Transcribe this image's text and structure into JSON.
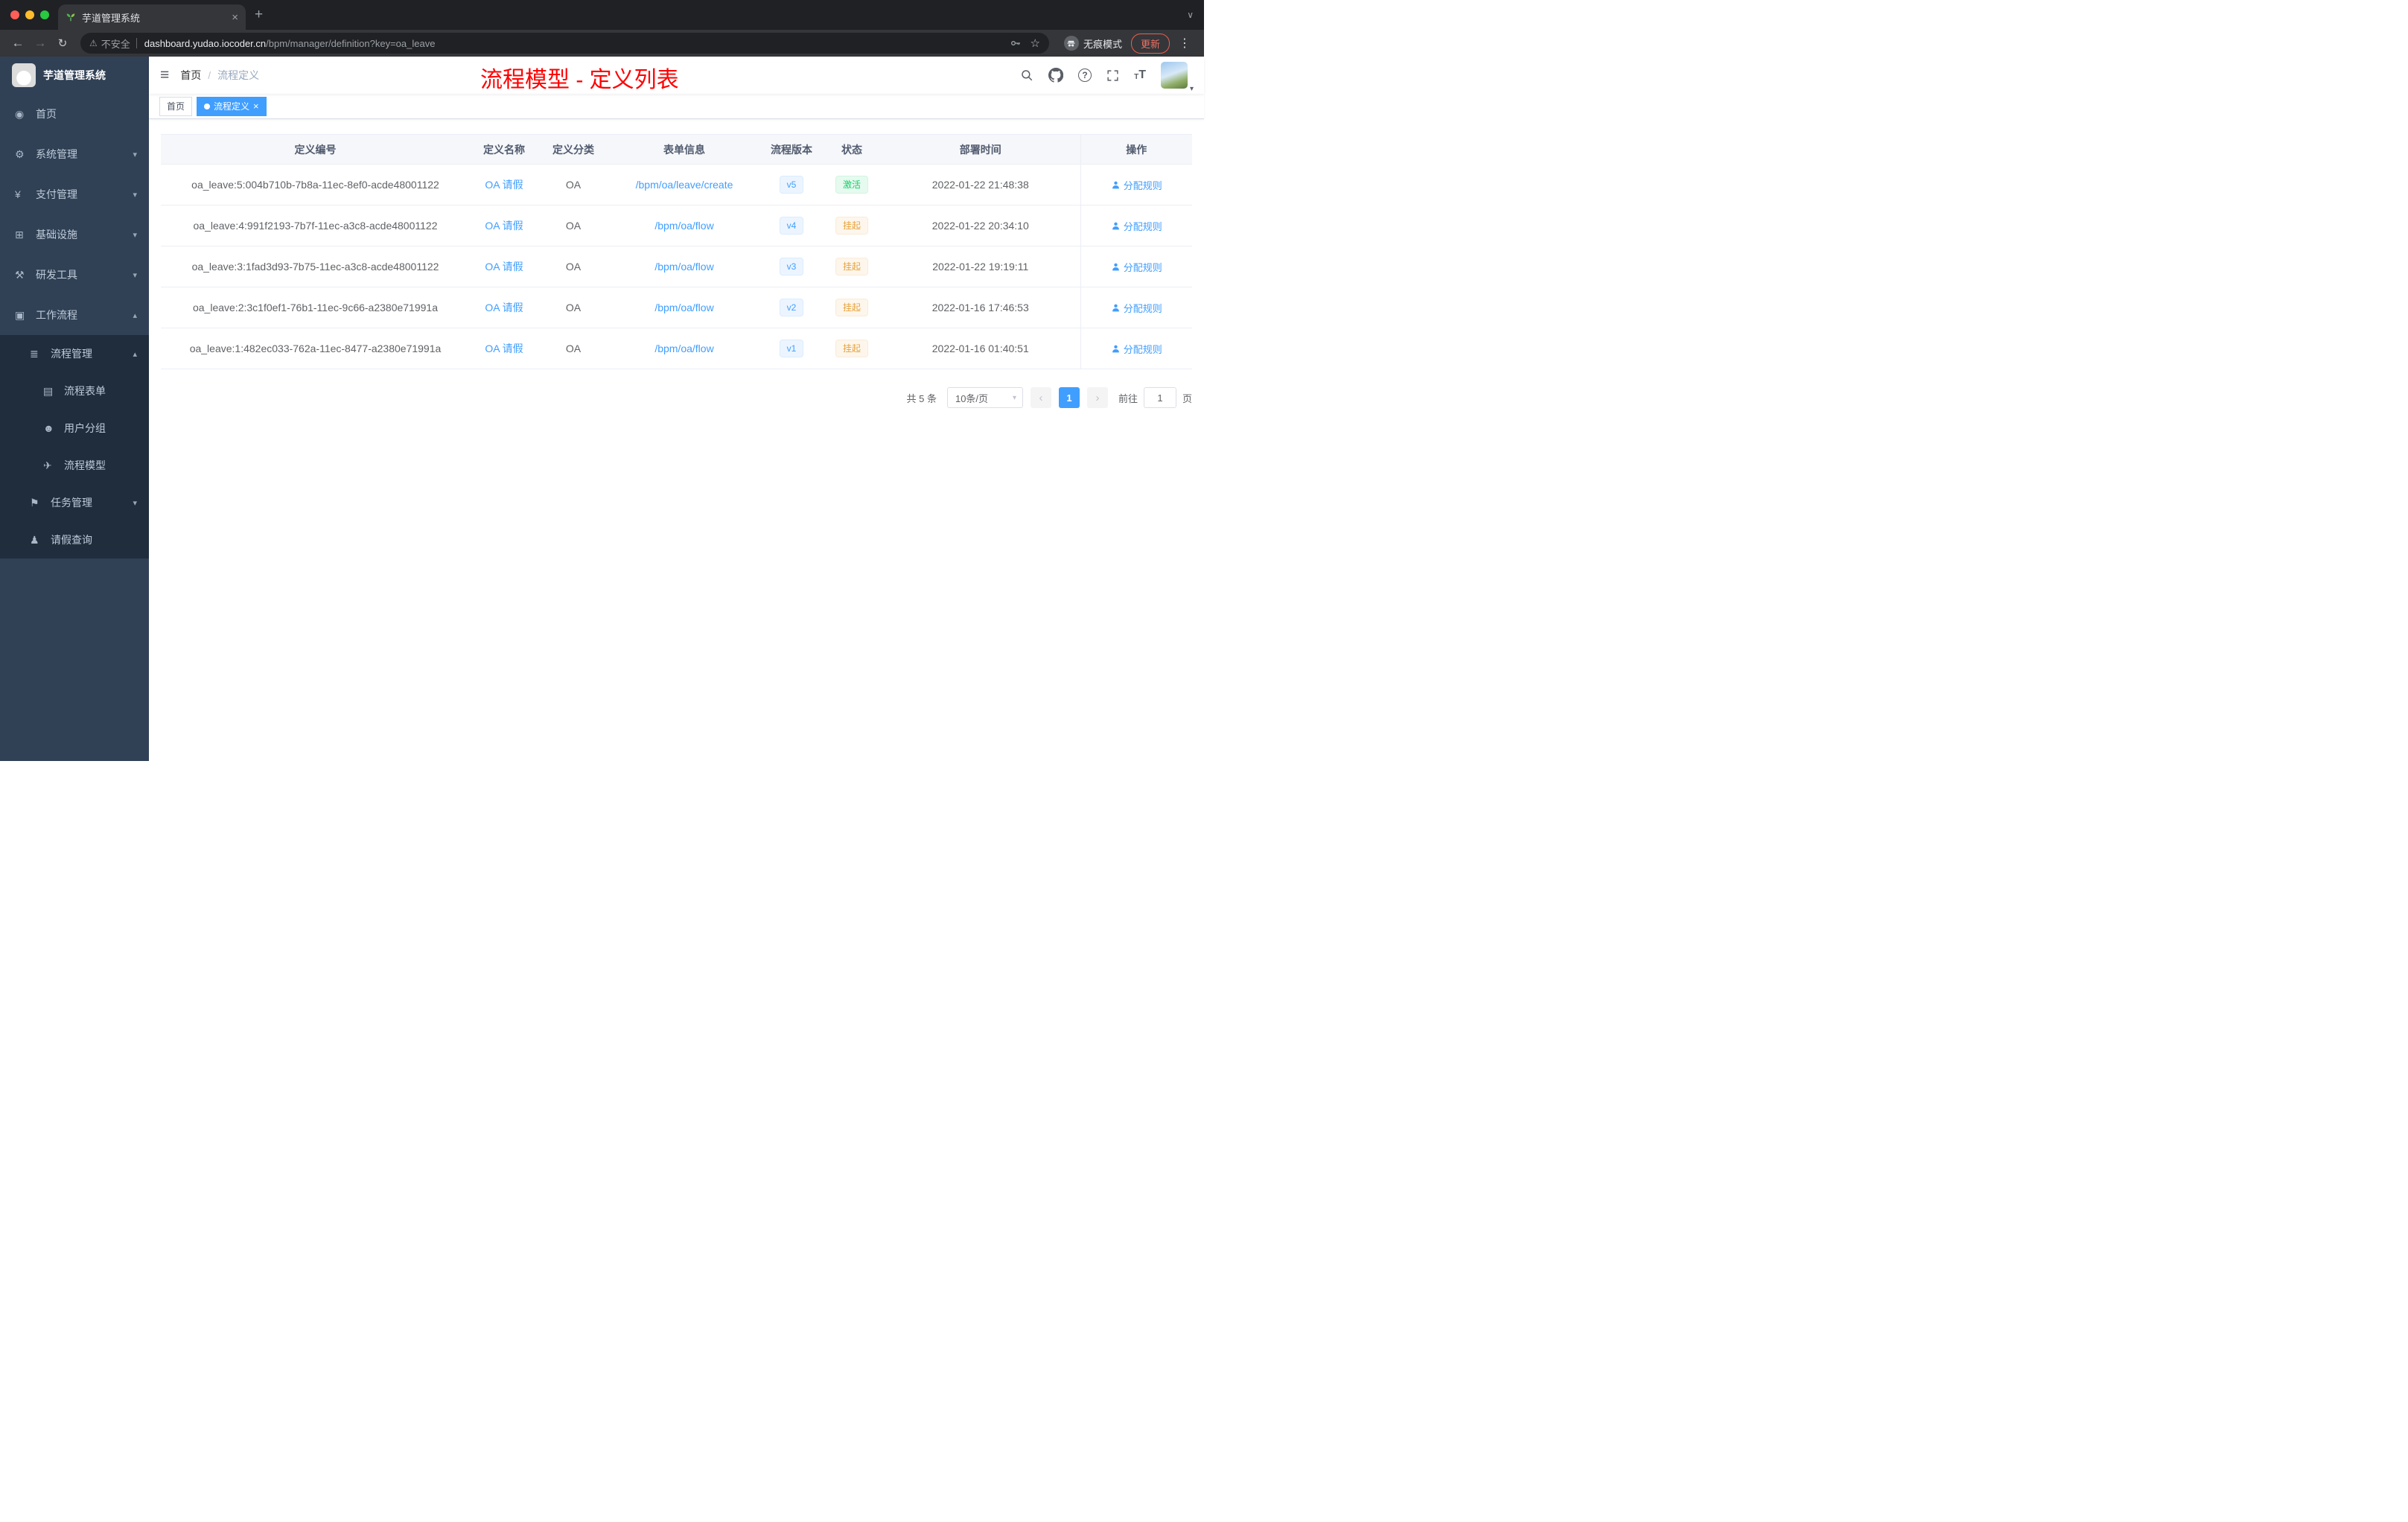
{
  "browser": {
    "tab_title": "芋道管理系统",
    "security_label": "不安全",
    "url_host": "dashboard.yudao.iocoder.cn",
    "url_path": "/bpm/manager/definition?key=oa_leave",
    "incognito_label": "无痕模式",
    "update_label": "更新"
  },
  "icons": {
    "back": "←",
    "forward": "→",
    "reload": "↻",
    "warning": "⚠",
    "star": "☆",
    "overflow": "⋮",
    "close": "×",
    "new_tab": "+",
    "tab_search": "∨",
    "hamburger": "≡",
    "divider": "|",
    "breadcrumb_sep": "/",
    "page_prev": "‹",
    "page_next": "›",
    "select_caret": "▾",
    "avatar_caret": "▾",
    "question": "?",
    "textsize_small": "T",
    "textsize_big": "T"
  },
  "sidebar": {
    "app_title": "芋道管理系统",
    "menu": [
      {
        "name": "sidebar-item-home",
        "icon": "dashboard-icon",
        "glyph": "◉",
        "label": "首页",
        "cls": "top",
        "chev": ""
      },
      {
        "name": "sidebar-item-system-management",
        "icon": "gear-icon",
        "glyph": "⚙",
        "label": "系统管理",
        "cls": "top",
        "chev": "▾"
      },
      {
        "name": "sidebar-item-payment-management",
        "icon": "yen-icon",
        "glyph": "¥",
        "label": "支付管理",
        "cls": "top",
        "chev": "▾"
      },
      {
        "name": "sidebar-item-infrastructure",
        "icon": "infrastructure-icon",
        "glyph": "⊞",
        "label": "基础设施",
        "cls": "top",
        "chev": "▾"
      },
      {
        "name": "sidebar-item-dev-tools",
        "icon": "tools-icon",
        "glyph": "⚒",
        "label": "研发工具",
        "cls": "top",
        "chev": "▾"
      },
      {
        "name": "sidebar-item-workflow",
        "icon": "workflow-icon",
        "glyph": "▣",
        "label": "工作流程",
        "cls": "top",
        "chev": "▴"
      },
      {
        "name": "sidebar-item-process-management",
        "icon": "process-management-icon",
        "glyph": "≣",
        "label": "流程管理",
        "cls": "sub",
        "chev": "▴"
      },
      {
        "name": "sidebar-item-process-form",
        "icon": "form-icon",
        "glyph": "▤",
        "label": "流程表单",
        "cls": "sub2",
        "chev": ""
      },
      {
        "name": "sidebar-item-user-group",
        "icon": "user-group-icon",
        "glyph": "☻",
        "label": "用户分组",
        "cls": "sub2",
        "chev": ""
      },
      {
        "name": "sidebar-item-process-model",
        "icon": "paper-plane-icon",
        "glyph": "✈",
        "label": "流程模型",
        "cls": "sub2",
        "chev": ""
      },
      {
        "name": "sidebar-item-task-management",
        "icon": "task-icon",
        "glyph": "⚑",
        "label": "任务管理",
        "cls": "sub",
        "chev": "▾"
      },
      {
        "name": "sidebar-item-leave-query",
        "icon": "user-icon",
        "glyph": "♟",
        "label": "请假查询",
        "cls": "sub",
        "chev": ""
      }
    ]
  },
  "header": {
    "breadcrumb_home": "首页",
    "breadcrumb_current": "流程定义",
    "annotation": "流程模型 - 定义列表"
  },
  "tags": {
    "home": "首页",
    "current": "流程定义"
  },
  "table": {
    "columns": [
      "定义编号",
      "定义名称",
      "定义分类",
      "表单信息",
      "流程版本",
      "状态",
      "部署时间",
      "操作"
    ],
    "rows": [
      {
        "id": "oa_leave:5:004b710b-7b8a-11ec-8ef0-acde48001122",
        "name": "OA 请假",
        "category": "OA",
        "form": "/bpm/oa/leave/create",
        "version": "v5",
        "status": "激活",
        "status_type": "success",
        "deploy_time": "2022-01-22 21:48:38",
        "action": "分配规则"
      },
      {
        "id": "oa_leave:4:991f2193-7b7f-11ec-a3c8-acde48001122",
        "name": "OA 请假",
        "category": "OA",
        "form": "/bpm/oa/flow",
        "version": "v4",
        "status": "挂起",
        "status_type": "warning",
        "deploy_time": "2022-01-22 20:34:10",
        "action": "分配规则"
      },
      {
        "id": "oa_leave:3:1fad3d93-7b75-11ec-a3c8-acde48001122",
        "name": "OA 请假",
        "category": "OA",
        "form": "/bpm/oa/flow",
        "version": "v3",
        "status": "挂起",
        "status_type": "warning",
        "deploy_time": "2022-01-22 19:19:11",
        "action": "分配规则"
      },
      {
        "id": "oa_leave:2:3c1f0ef1-76b1-11ec-9c66-a2380e71991a",
        "name": "OA 请假",
        "category": "OA",
        "form": "/bpm/oa/flow",
        "version": "v2",
        "status": "挂起",
        "status_type": "warning",
        "deploy_time": "2022-01-16 17:46:53",
        "action": "分配规则"
      },
      {
        "id": "oa_leave:1:482ec033-762a-11ec-8477-a2380e71991a",
        "name": "OA 请假",
        "category": "OA",
        "form": "/bpm/oa/flow",
        "version": "v1",
        "status": "挂起",
        "status_type": "warning",
        "deploy_time": "2022-01-16 01:40:51",
        "action": "分配规则"
      }
    ]
  },
  "pagination": {
    "total": "共 5 条",
    "page_size": "10条/页",
    "page": "1",
    "goto_label": "前往",
    "goto_value": "1",
    "page_unit": "页"
  }
}
